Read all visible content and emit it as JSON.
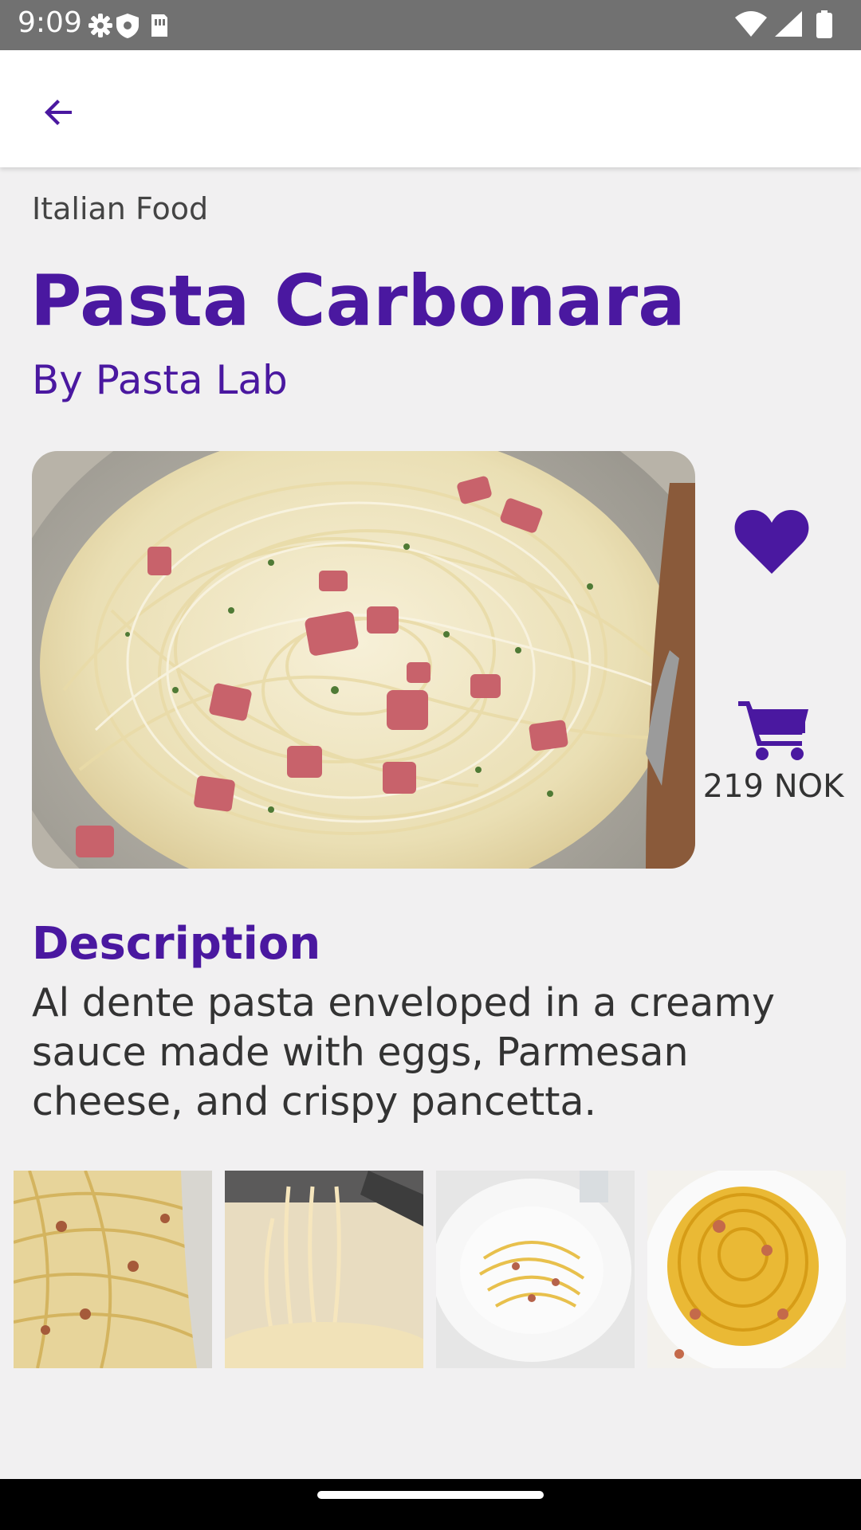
{
  "status": {
    "time": "9:09"
  },
  "app_bar": {
    "back_icon": "arrow-left-icon"
  },
  "recipe": {
    "category": "Italian Food",
    "title": "Pasta Carbonara",
    "author": "By Pasta Lab",
    "price": "219 NOK",
    "description_heading": "Description",
    "description": "Al dente pasta enveloped in a creamy sauce made with eggs, Parmesan cheese, and crispy pancetta."
  },
  "colors": {
    "accent": "#4a18a0",
    "background": "#f1f0f1",
    "status_bar": "#717171"
  },
  "icons": {
    "favorite": "heart-icon",
    "cart": "cart-icon"
  }
}
